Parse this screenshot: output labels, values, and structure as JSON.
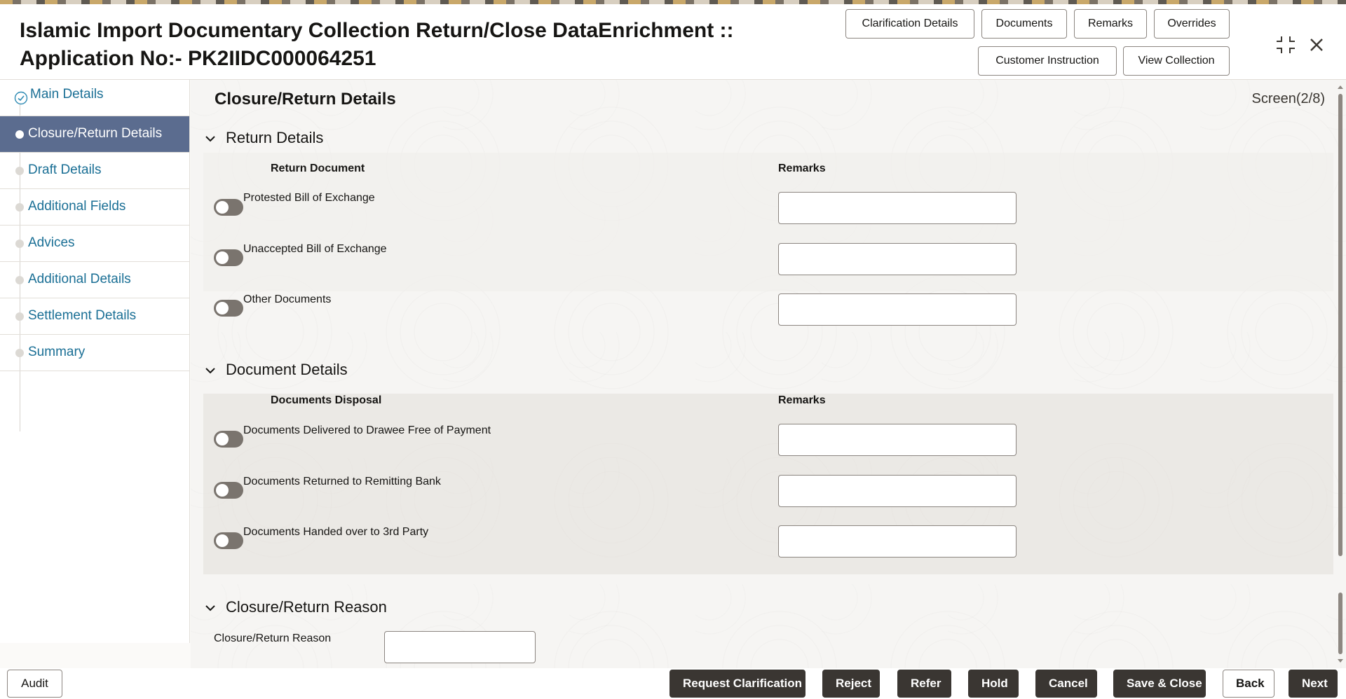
{
  "header": {
    "title_line1": "Islamic Import Documentary Collection Return/Close DataEnrichment ::",
    "title_line2": "Application No:- PK2IIDC000064251",
    "buttons": {
      "clarification_details": "Clarification Details",
      "documents": "Documents",
      "remarks": "Remarks",
      "overrides": "Overrides",
      "customer_instruction": "Customer Instruction",
      "view_collection": "View Collection"
    }
  },
  "sidebar": {
    "items": [
      {
        "label": "Main Details",
        "state": "completed"
      },
      {
        "label": "Closure/Return Details",
        "state": "active"
      },
      {
        "label": "Draft Details",
        "state": "pending"
      },
      {
        "label": "Additional Fields",
        "state": "pending"
      },
      {
        "label": "Advices",
        "state": "pending"
      },
      {
        "label": "Additional Details",
        "state": "pending"
      },
      {
        "label": "Settlement Details",
        "state": "pending"
      },
      {
        "label": "Summary",
        "state": "pending"
      }
    ]
  },
  "main": {
    "title": "Closure/Return Details",
    "screen_indicator": "Screen(2/8)",
    "return_details": {
      "heading": "Return Details",
      "col_document": "Return Document",
      "col_remarks": "Remarks",
      "rows": [
        {
          "label": "Protested Bill of Exchange",
          "toggle": false,
          "remarks": ""
        },
        {
          "label": "Unaccepted Bill of Exchange",
          "toggle": false,
          "remarks": ""
        },
        {
          "label": "Other Documents",
          "toggle": false,
          "remarks": ""
        }
      ]
    },
    "document_details": {
      "heading": "Document Details",
      "col_document": "Documents Disposal",
      "col_remarks": "Remarks",
      "rows": [
        {
          "label": "Documents Delivered to Drawee Free of Payment",
          "toggle": false,
          "remarks": ""
        },
        {
          "label": "Documents Returned to Remitting Bank",
          "toggle": false,
          "remarks": ""
        },
        {
          "label": "Documents Handed over to 3rd Party",
          "toggle": false,
          "remarks": ""
        }
      ]
    },
    "closure_reason": {
      "heading": "Closure/Return Reason",
      "field_label": "Closure/Return Reason",
      "value": ""
    }
  },
  "footer": {
    "audit": "Audit",
    "request_clarification": "Request Clarification",
    "reject": "Reject",
    "refer": "Refer",
    "hold": "Hold",
    "cancel": "Cancel",
    "save_close": "Save & Close",
    "back": "Back",
    "next": "Next"
  },
  "colors": {
    "active_nav": "#5b6c8f",
    "link": "#1a6f95",
    "dark_button": "#3a3632",
    "toggle_off": "#7a746e"
  }
}
